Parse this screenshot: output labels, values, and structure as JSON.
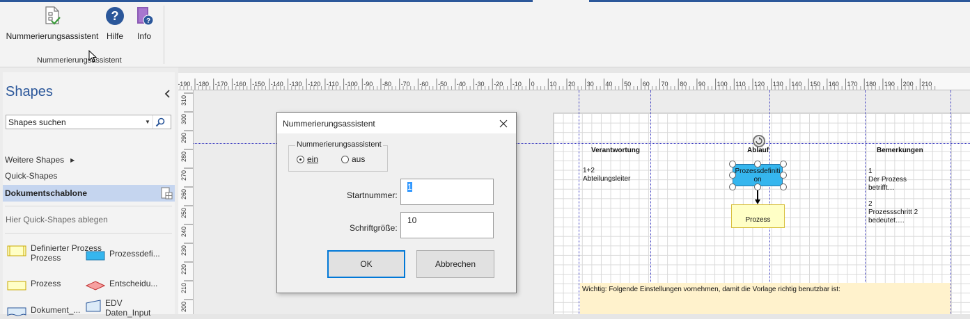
{
  "ribbon": {
    "buttons": [
      {
        "label": "Nummerierungsassistent",
        "icon": "numbering-wizard-icon"
      },
      {
        "label": "Hilfe",
        "icon": "help-icon"
      },
      {
        "label": "Info",
        "icon": "info-book-icon"
      }
    ],
    "group_label": "Nummerierungsassistent"
  },
  "shapes_pane": {
    "title": "Shapes",
    "search_value": "Shapes suchen",
    "nav": {
      "more_shapes": "Weitere Shapes",
      "quick_shapes": "Quick-Shapes",
      "active_stencil": "Dokumentschablone"
    },
    "drop_hint": "Hier Quick-Shapes ablegen",
    "stencils": [
      {
        "label": "Definierter Prozess",
        "line2": "Prozess"
      },
      {
        "label": "Prozessdefi..."
      },
      {
        "label": "Prozess"
      },
      {
        "label": "Entscheidu..."
      },
      {
        "label": "Dokument_..."
      },
      {
        "label": "EDV",
        "line2": "Daten_Input"
      }
    ]
  },
  "rulers": {
    "horizontal": [
      "-190",
      "-180",
      "-170",
      "-160",
      "-150",
      "-140",
      "-130",
      "-120",
      "-110",
      "-100",
      "-90",
      "-80",
      "-70",
      "-60",
      "-50",
      "-40",
      "-30",
      "-20",
      "-10",
      "0",
      "10",
      "20",
      "30",
      "40",
      "50",
      "60",
      "70",
      "80",
      "90",
      "100",
      "110",
      "120",
      "130",
      "140",
      "150",
      "160",
      "170",
      "180",
      "190",
      "200",
      "210"
    ],
    "vertical": [
      "310",
      "300",
      "290",
      "280",
      "270",
      "260",
      "250",
      "240",
      "230",
      "220",
      "210",
      "200"
    ]
  },
  "diagram": {
    "columns": {
      "responsibility": "Verantwortung",
      "flow": "Ablauf",
      "remarks": "Bemerkungen"
    },
    "responsibility_lines": [
      "1+2",
      "Abteilungsleiter"
    ],
    "process_definition": [
      "Prozessdefiniti",
      "on"
    ],
    "process": "Prozess",
    "remark_lines_1": [
      "1",
      "Der Prozess",
      "betrifft…"
    ],
    "remark_lines_2": [
      "2",
      "Prozessschritt 2",
      "bedeutet…."
    ],
    "note": "Wichtig: Folgende Einstellungen vornehmen, damit die Vorlage richtig benutzbar ist:"
  },
  "dialog": {
    "title": "Nummerierungsassistent",
    "group_label": "Nummerierungsassistent",
    "radio_on": "ein",
    "radio_off": "aus",
    "radio_selected": "ein",
    "start_label": "Startnummer:",
    "start_value": "1",
    "font_label": "Schriftgröße:",
    "font_value": "10",
    "ok_label": "OK",
    "cancel_label": "Abbrechen"
  },
  "colors": {
    "accent": "#2b579a",
    "active_stencil_bg": "#c5d5ef",
    "process_def_fill": "#35b6ee",
    "process_fill": "#ffffc6",
    "note_fill": "#fff2cc"
  }
}
